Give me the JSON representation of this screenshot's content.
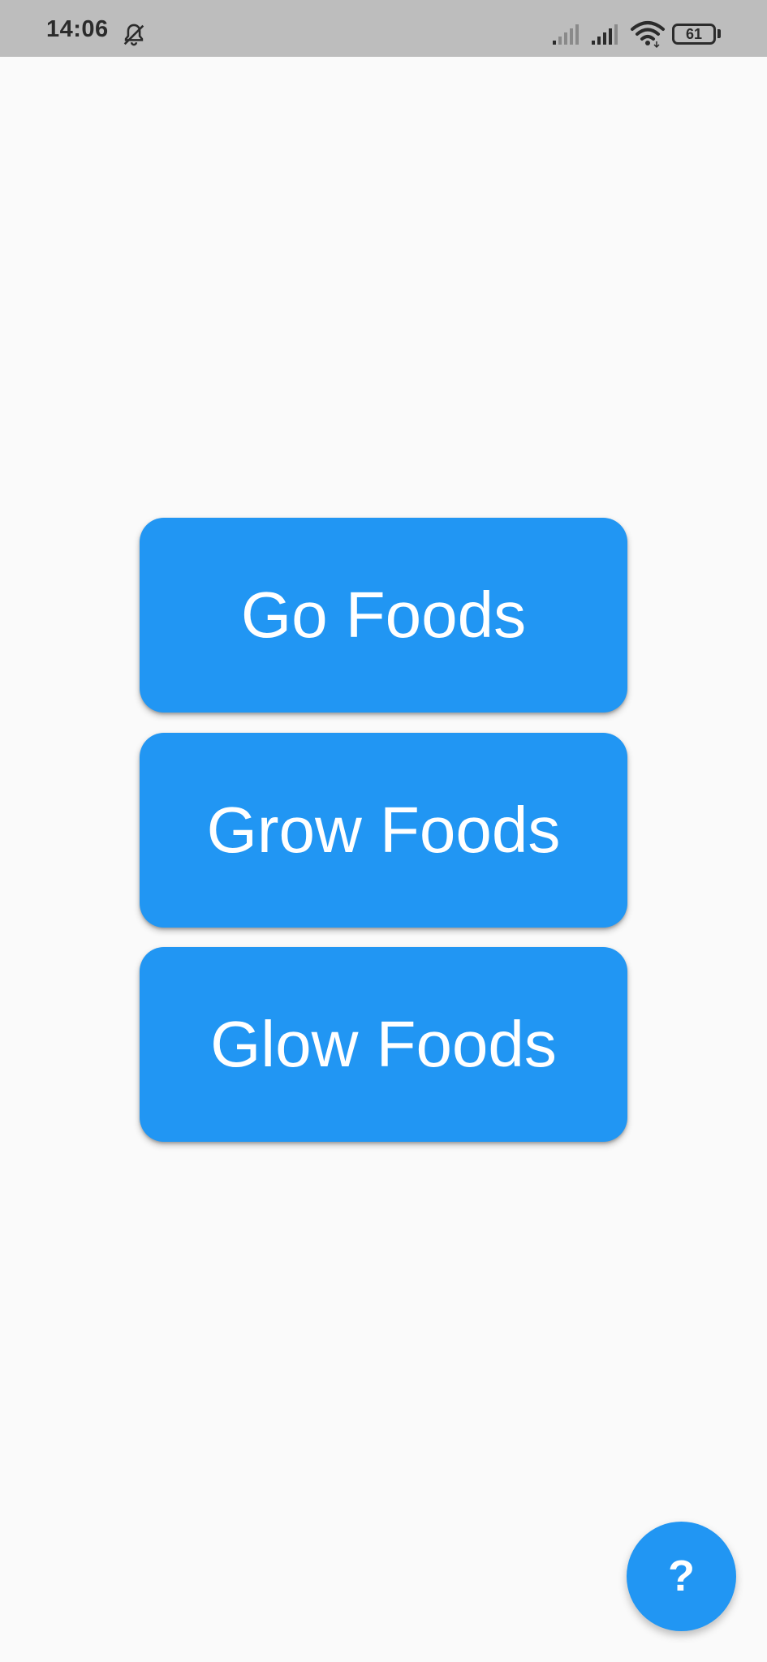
{
  "status_bar": {
    "time": "14:06",
    "battery_level": "61",
    "icons": [
      "bell-muted-icon",
      "signal-weak-icon",
      "signal-icon",
      "wifi-icon",
      "battery-icon"
    ]
  },
  "menu": {
    "items": [
      {
        "label": "Go Foods"
      },
      {
        "label": "Grow Foods"
      },
      {
        "label": "Glow Foods"
      }
    ]
  },
  "fab": {
    "label": "?"
  },
  "colors": {
    "accent": "#2196f3",
    "background": "#fafafa",
    "status_bar": "#bdbdbd"
  }
}
